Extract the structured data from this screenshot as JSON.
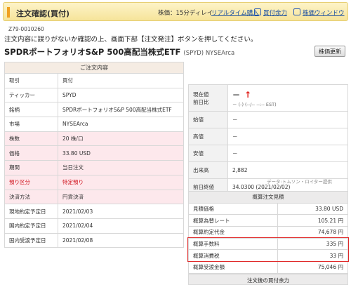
{
  "header": {
    "title": "注文確認(買付)",
    "delay": "株価：15分ディレイ",
    "realtime_link": "リアルタイム購入",
    "buying_power_link": "買付余力",
    "stock_window_link": "株価ウィンドウ"
  },
  "order_id": "Z79-0010260",
  "notice": "注文内容に誤りがないか確認の上、画面下部【注文発注】ボタンを押してください。",
  "stock": {
    "name": "SPDRポートフォリオS&P 500高配当株式ETF",
    "code_market": "(SPYD) NYSEArca",
    "refresh_label": "株価更新"
  },
  "order": {
    "heading": "ご注文内容",
    "rows": [
      {
        "k": "取引",
        "v": "買付"
      },
      {
        "k": "ティッカー",
        "v": "SPYD"
      },
      {
        "k": "銘柄",
        "v": "SPDRポートフォリオS&P 500高配当株式ETF"
      },
      {
        "k": "市場",
        "v": "NYSEArca"
      },
      {
        "k": "株数",
        "v": "20 株/口"
      },
      {
        "k": "価格",
        "v": "33.80 USD"
      },
      {
        "k": "期間",
        "v": "当日注文"
      },
      {
        "k": "預り区分",
        "v": "特定預り"
      },
      {
        "k": "決済方法",
        "v": "円貨決済"
      },
      {
        "k": "現地約定予定日",
        "v": "2021/02/03"
      },
      {
        "k": "国内約定予定日",
        "v": "2021/02/04"
      },
      {
        "k": "国内受渡予定日",
        "v": "2021/02/08"
      }
    ]
  },
  "quote": {
    "current_label": "現在値",
    "prev_label": "前日比",
    "current_value": "－",
    "arrow": "↑",
    "prev_value": "－ (-) (--/-- --:-- EST)",
    "rows": [
      {
        "k": "始値",
        "v": "－"
      },
      {
        "k": "高値",
        "v": "－"
      },
      {
        "k": "安値",
        "v": "－"
      },
      {
        "k": "出来高",
        "v": "2,882"
      },
      {
        "k": "前日終値",
        "v": "34.0300 (2021/02/02)"
      }
    ],
    "source": "データ:トムソン・ロイター提供"
  },
  "estimate": {
    "heading": "概算注文見積",
    "rows": [
      {
        "k": "見積価格",
        "v": "33.80 USD"
      },
      {
        "k": "概算為替レート",
        "v": "105.21 円"
      },
      {
        "k": "概算約定代金",
        "v": "74,678 円"
      },
      {
        "k": "概算手数料",
        "v": "335 円"
      },
      {
        "k": "概算消費税",
        "v": "33 円"
      },
      {
        "k": "概算受渡金額",
        "v": "75,046 円"
      }
    ]
  },
  "after_label": "注文後の買付余力",
  "colors": {
    "accent": "#f0a020",
    "alert": "#d0101a",
    "link": "#1a4fa0"
  }
}
